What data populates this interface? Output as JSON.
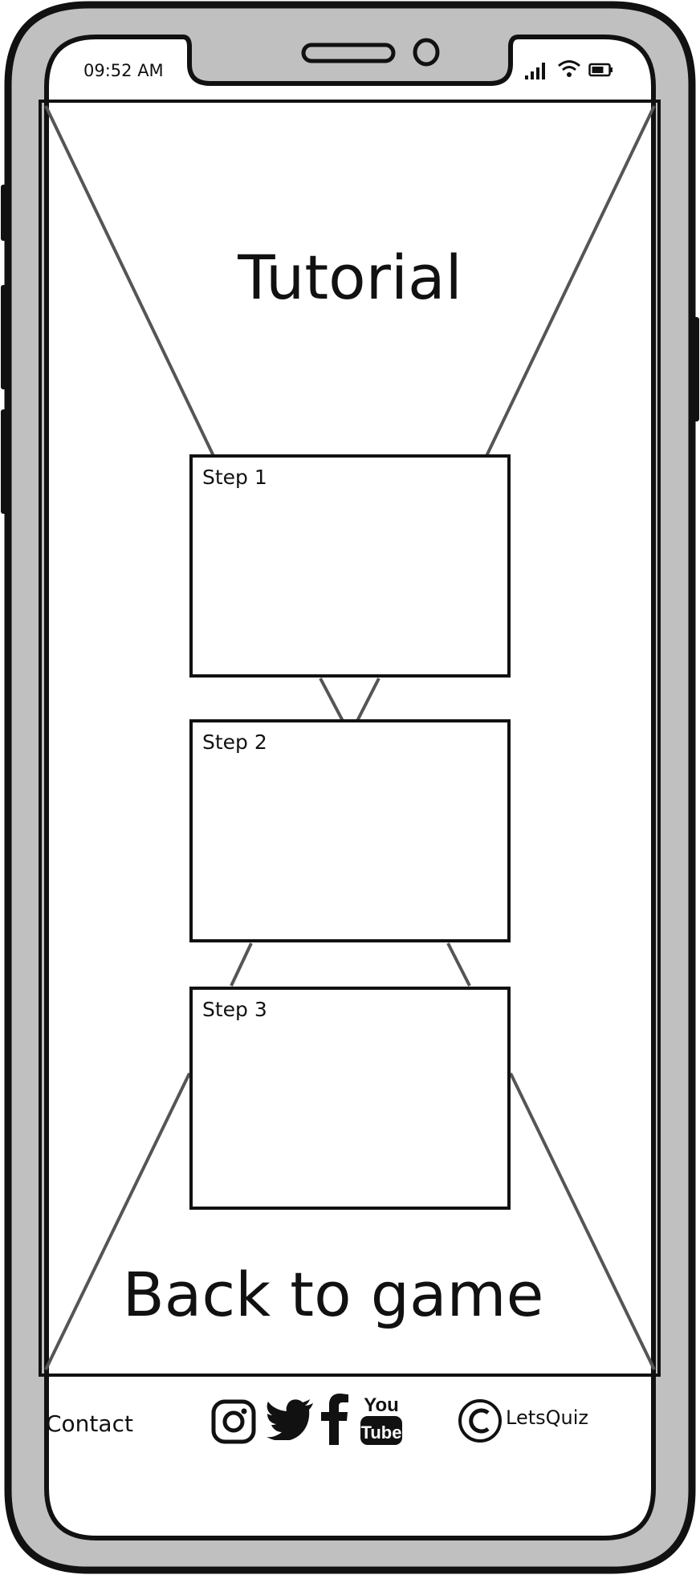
{
  "status_bar": {
    "time": "09:52 AM",
    "icons": [
      "signal-icon",
      "wifi-icon",
      "battery-icon"
    ]
  },
  "page": {
    "title": "Tutorial",
    "steps": [
      {
        "label": "Step 1"
      },
      {
        "label": "Step 2"
      },
      {
        "label": "Step 3"
      }
    ],
    "back_button": "Back to game"
  },
  "footer": {
    "contact": "Contact",
    "social_icons": [
      "instagram-icon",
      "twitter-icon",
      "facebook-icon",
      "youtube-icon"
    ],
    "copyright_symbol": "copyright-icon",
    "brand": "LetsQuiz"
  }
}
